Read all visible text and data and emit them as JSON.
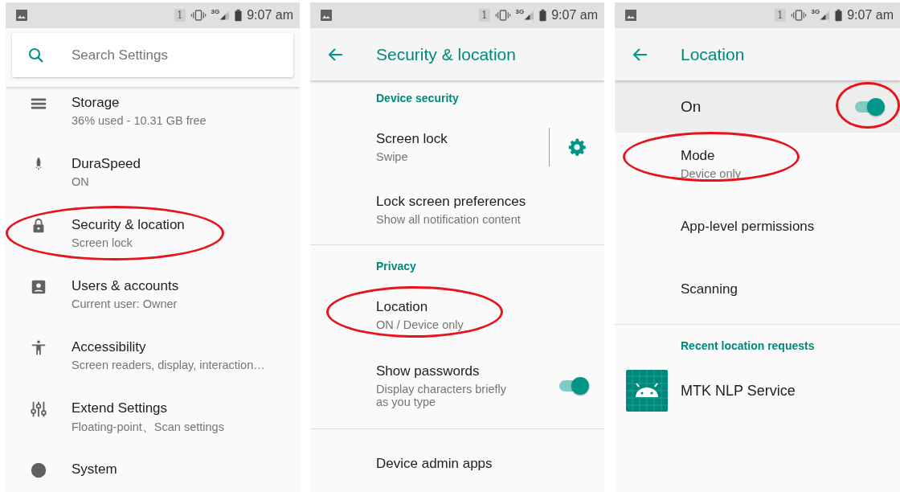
{
  "panels": [
    {
      "kind": "search",
      "status": {
        "sim": "1",
        "network": "3G",
        "time": "9:07 am"
      },
      "search": {
        "placeholder": "Search Settings"
      },
      "entries": [
        {
          "kind": "item",
          "title": "Storage",
          "subtitle": "36% used - 10.31 GB free",
          "circled": false
        },
        {
          "kind": "item",
          "title": "DuraSpeed",
          "subtitle": "ON",
          "circled": false
        },
        {
          "kind": "item",
          "title": "Security & location",
          "subtitle": "Screen lock",
          "circled": true
        },
        {
          "kind": "item",
          "title": "Users & accounts",
          "subtitle": "Current user: Owner",
          "circled": false
        },
        {
          "kind": "item",
          "title": "Accessibility",
          "subtitle": "Screen readers, display, interaction…",
          "circled": false
        },
        {
          "kind": "item",
          "title": "Extend Settings",
          "subtitle": "Floating-point、Scan settings",
          "circled": false
        },
        {
          "kind": "item",
          "title": "System",
          "circled": false
        }
      ]
    },
    {
      "kind": "page",
      "status": {
        "sim": "1",
        "network": "3G",
        "time": "9:07 am"
      },
      "title": "Security & location",
      "entries": [
        {
          "kind": "header",
          "title": "Device security"
        },
        {
          "kind": "gear",
          "title": "Screen lock",
          "subtitle": "Swipe",
          "circled": false
        },
        {
          "kind": "item",
          "title": "Lock screen preferences",
          "subtitle": "Show all notification content",
          "circled": false
        },
        {
          "kind": "divider"
        },
        {
          "kind": "header",
          "title": "Privacy"
        },
        {
          "kind": "item",
          "title": "Location",
          "subtitle": "ON / Device only",
          "circled": true
        },
        {
          "kind": "switch",
          "title": "Show passwords",
          "subtitle": "Display characters briefly as you type",
          "on": true,
          "circled": false
        },
        {
          "kind": "divider"
        },
        {
          "kind": "item",
          "title": "Device admin apps",
          "circled": false
        }
      ]
    },
    {
      "kind": "page",
      "status": {
        "sim": "1",
        "network": "3G",
        "time": "9:07 am"
      },
      "title": "Location",
      "master": {
        "label": "On",
        "on": true,
        "circled": true
      },
      "entries": [
        {
          "kind": "item",
          "title": "Mode",
          "subtitle": "Device only",
          "circled": true
        },
        {
          "kind": "item",
          "title": "App-level permissions",
          "circled": false
        },
        {
          "kind": "item",
          "title": "Scanning",
          "circled": false
        },
        {
          "kind": "divider"
        },
        {
          "kind": "header",
          "title": "Recent location requests"
        },
        {
          "kind": "app",
          "title": "MTK NLP Service",
          "circled": false
        }
      ]
    }
  ]
}
